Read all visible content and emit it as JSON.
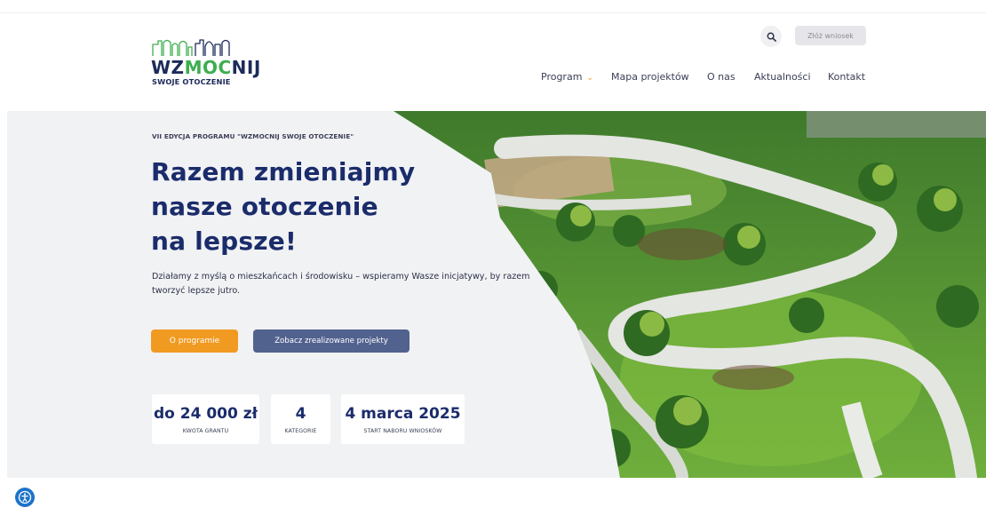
{
  "header": {
    "logo": {
      "main_prefix": "WZ",
      "main_accent": "MOC",
      "main_suffix": "NIJ",
      "sub": "SWOJE OTOCZENIE"
    },
    "search_icon": "search-icon",
    "apply_label": "Złóż wniosek"
  },
  "nav": {
    "items": [
      {
        "label": "Program",
        "has_dropdown": true
      },
      {
        "label": "Mapa projektów"
      },
      {
        "label": "O nas"
      },
      {
        "label": "Aktualności"
      },
      {
        "label": "Kontakt"
      }
    ]
  },
  "hero": {
    "eyebrow": "VII EDYCJA PROGRAMU \"WZMOCNIJ SWOJE OTOCZENIE\"",
    "title_lines": [
      "Razem zmieniajmy",
      "nasze otoczenie",
      "na lepsze!"
    ],
    "description": "Działamy z myślą o mieszkańcach i środowisku – wspieramy Wasze inicjatywy, by razem tworzyć lepsze jutro.",
    "primary_button": "O programie",
    "secondary_button": "Zobacz zrealizowane projekty",
    "stats": [
      {
        "value": "do 24 000 zł",
        "label": "KWOTA GRANTU"
      },
      {
        "value": "4",
        "label": "KATEGORIE"
      },
      {
        "value": "4 marca 2025",
        "label": "START NABORU WNIOSKÓW"
      }
    ]
  },
  "accessibility": {
    "icon": "accessibility-icon"
  },
  "colors": {
    "navy": "#1b2c6b",
    "green": "#3cae4f",
    "orange": "#f19a21",
    "slate_button": "#52628f",
    "hero_bg": "#f1f2f4",
    "a11y_blue": "#1d73c9"
  }
}
